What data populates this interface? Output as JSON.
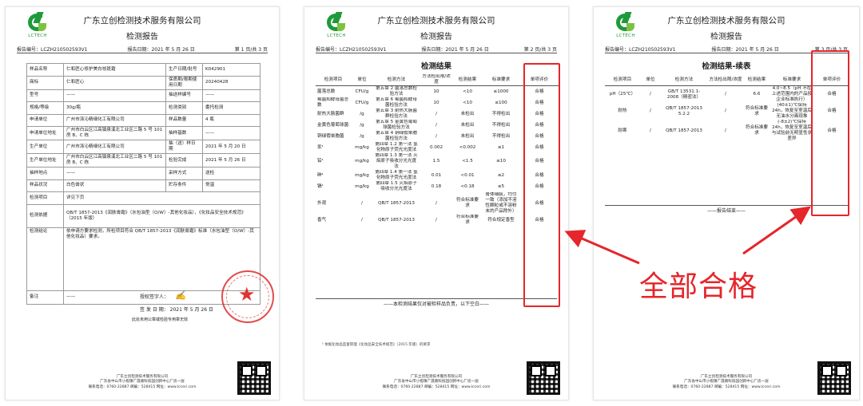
{
  "company": "广东立创检测技术服务有限公司",
  "logo_text": "LCTECH",
  "pages": [
    {
      "title": "检测报告",
      "report_no": "报告编号：LCZH210502593V1",
      "date": "报告日期：2021 年 5 月 26 日",
      "page": "第 1 页/共 3 页",
      "rows": [
        {
          "k1": "样品名称",
          "v1": "仁和匠心修护美白祛斑霜",
          "k2": "生产日期/批号",
          "v2": "K042901"
        },
        {
          "k1": "商标",
          "v1": "仁和匠心",
          "k2": "保质期/限期使用日期",
          "v2": "20240428"
        },
        {
          "k1": "型号",
          "v1": "——",
          "k2": "抽送样编号",
          "v2": "——"
        },
        {
          "k1": "规格/等级",
          "v1": "30g/瓶",
          "k2": "检测类别",
          "v2": "委托检测"
        },
        {
          "k1": "申请单位",
          "v1": "广州市涤沁精细化工有限公司",
          "k2": "样品数量",
          "v2": "4 瓶"
        },
        {
          "k1": "申请单位地址",
          "v1": "广州市白云区江高镇泉溪北工业区二路 5 号 101 房 B、C 栋",
          "k2": "抽样基数",
          "v2": "——"
        },
        {
          "k1": "生产单位",
          "v1": "广州市涤沁精细化工有限公司",
          "k2": "抽（送）样日期",
          "v2": "2021 年 5 月 20 日"
        },
        {
          "k1": "生产单位地址",
          "v1": "广州市白云区江高镇泉溪北工业区二路 5 号 101 房 B、C 栋",
          "k2": "检验完成",
          "v2": "2021 年 5 月 26 日"
        },
        {
          "k1": "抽样地点",
          "v1": "——",
          "k2": "采样方式",
          "v2": "送检"
        },
        {
          "k1": "样品状况",
          "v1": "白色膏状",
          "k2": "贮存条件",
          "v2": "常温"
        }
      ],
      "item_label": "检测项目",
      "item_value": "详见下页",
      "basis_label": "检测依据",
      "basis_value": "QB/T 1857-2013《润肤膏霜》（水包油型（O/W）-其他化妆品），《化妆品安全技术规范》（2015 年版）",
      "conclusion_label": "检测结论",
      "conclusion_value": "依申请方要求检测，所检项目符合 QB/T 1857-2013《润肤膏霜》标准（水包油型（O/W）-其他化妆品）要求。",
      "sign_label": "授权签字人：",
      "sign_date_label": "签 发 日 期：",
      "sign_date": "2021 年 5 月 26 日",
      "sign_note": "此处未用公章或检验专用章无效",
      "remark_label": "备注",
      "remark_value": "——"
    },
    {
      "title": "检测报告",
      "report_no": "报告编号：LCZH210502593V1",
      "date": "报告日期：2021 年 5 月 26 日",
      "page": "第 2 页/共 3 页",
      "section": "检测结果",
      "headers": [
        "检测项目",
        "单位",
        "检测方法",
        "方法检出限/浓度",
        "检测结果",
        "标准要求",
        "单项评价"
      ],
      "rows": [
        [
          "菌落总数",
          "CFU/g",
          "第五章 2 菌落总数检验方法",
          "10",
          "<10",
          "≤1000",
          "合格"
        ],
        [
          "霉菌和酵母菌总数",
          "CFU/g",
          "第五章 6 霉菌和酵母菌检验方法",
          "10",
          "<10",
          "≤100",
          "合格"
        ],
        [
          "耐热大肠菌群",
          "/g",
          "第五章 3 耐热大肠菌群检验方法",
          "/",
          "未检出",
          "不得检出",
          "合格"
        ],
        [
          "金黄色葡萄球菌",
          "/g",
          "第五章 5 金黄色葡萄球菌检验方法",
          "/",
          "未检出",
          "不得检出",
          "合格"
        ],
        [
          "铜绿假单胞菌",
          "/g",
          "第五章 4 铜绿假单胞菌检验方法",
          "/",
          "未检出",
          "不得检出",
          "合格"
        ],
        [
          "汞¹",
          "mg/kg",
          "第四章 1.2 第一法 氢化物原子荧光光度法",
          "0.002",
          "<0.002",
          "≤1",
          "合格"
        ],
        [
          "铅¹",
          "mg/kg",
          "第四章 1.3 第一法 火焰原子吸收分光光度法",
          "1.5",
          "<1.5",
          "≤10",
          "合格"
        ],
        [
          "砷¹",
          "mg/kg",
          "第四章 1.4 第一法 氢化物原子荧光光度法",
          "0.01",
          "<0.01",
          "≤2",
          "合格"
        ],
        [
          "镉¹",
          "mg/kg",
          "第四章 1.5 火焰原子吸收分光光度法",
          "0.18",
          "<0.18",
          "≤5",
          "合格"
        ],
        [
          "外观",
          "/",
          "QB/T 1857-2013",
          "/",
          "符合标准要求",
          "膏体细腻，均匀一致（添加不溶性颗粒或不溶粉末的产品除外）",
          "合格"
        ],
        [
          "香气",
          "/",
          "QB/T 1857-2013",
          "/",
          "符合标准要求",
          "符合规定香型",
          "合格"
        ]
      ],
      "end": "——本检测结果仅对被检样品负责，以下空白——",
      "footnote": "¹ 依据化妆品监督管理《化妆品安全技术规范》（2015 年版）的要求"
    },
    {
      "title": "检测报告",
      "report_no": "报告编号：LCZH210502593V1",
      "date": "报告日期：2021 年 5 月 26 日",
      "page": "第 3 页/共 3 页",
      "section": "检测结果-续表",
      "headers": [
        "检测项目",
        "单位",
        "检测方法",
        "方法检出限/浓度",
        "检测结果",
        "标准要求",
        "单项评价"
      ],
      "rows": [
        [
          "pH（25℃）",
          "/",
          "GB/T 13531.1-2008（精密法）",
          "/",
          "6.6",
          "4.0~8.5（pH 不在上述范围内的产品按企业标准执行）",
          "合格"
        ],
        [
          "耐热",
          "/",
          "QB/T 1857-2013 5.2.2",
          "/",
          "符合标准要求",
          "(40±1)℃保持 24h，恢复至室温后无油水分离现象",
          "合格"
        ],
        [
          "耐寒",
          "/",
          "QB/T 1857-2013",
          "/",
          "符合标准要求",
          "(-8±2)℃保持 24h，恢复至室温后与试验前无明显性状差异",
          "合格"
        ]
      ],
      "end": "——报告结束——"
    }
  ],
  "footer": {
    "line1": "广东立创检测技术服务有限公司",
    "line2": "广东省中山市小榄镇广晟路科技园创新中心厂房一层",
    "line3": "联系电话：0760-22887  邮编：528415  网址：www.lcceri.com"
  },
  "annotation": {
    "callout": "全部合格",
    "color": "#e5262a"
  }
}
